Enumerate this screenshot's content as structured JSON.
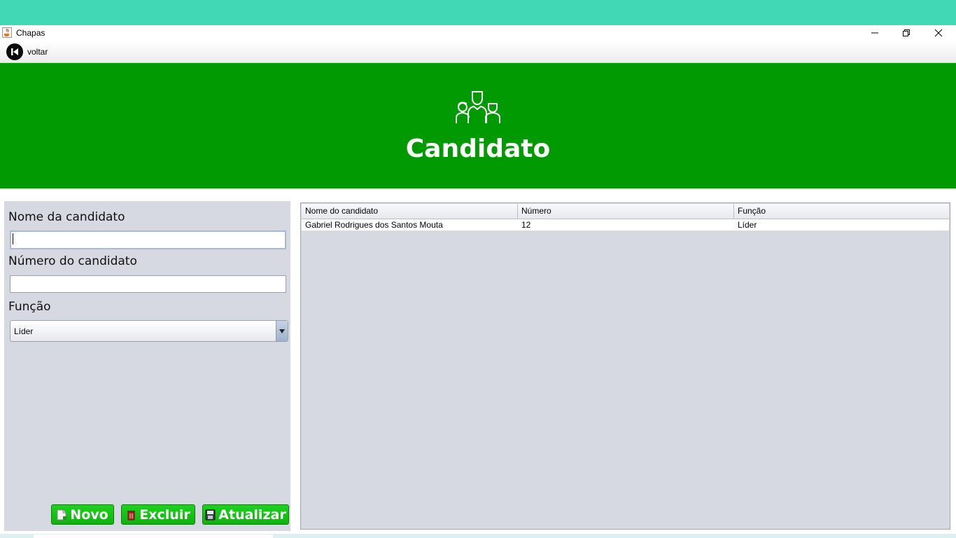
{
  "window": {
    "title": "Chapas",
    "icon": "java-cup-icon"
  },
  "menu": {
    "back_label": "voltar",
    "back_icon": "skip-back-icon"
  },
  "header": {
    "title": "Candidato",
    "icon": "people-group-icon",
    "background": "#029a02"
  },
  "form": {
    "name_label": "Nome da candidato",
    "name_value": "",
    "number_label": "Número do candidato",
    "number_value": "",
    "role_label": "Função",
    "role_selected": "Líder"
  },
  "buttons": {
    "new_label": "Novo",
    "delete_label": "Excluir",
    "update_label": "Atualizar"
  },
  "table": {
    "columns": [
      "Nome do candidato",
      "Número",
      "Função"
    ],
    "rows": [
      {
        "name": "Gabriel Rodrigues dos Santos Mouta",
        "number": "12",
        "role": "Líder"
      }
    ]
  },
  "colors": {
    "accent": "#029a02",
    "button": "#14c414",
    "panel": "#d6d9e1",
    "top_strip": "#41d9b5"
  }
}
